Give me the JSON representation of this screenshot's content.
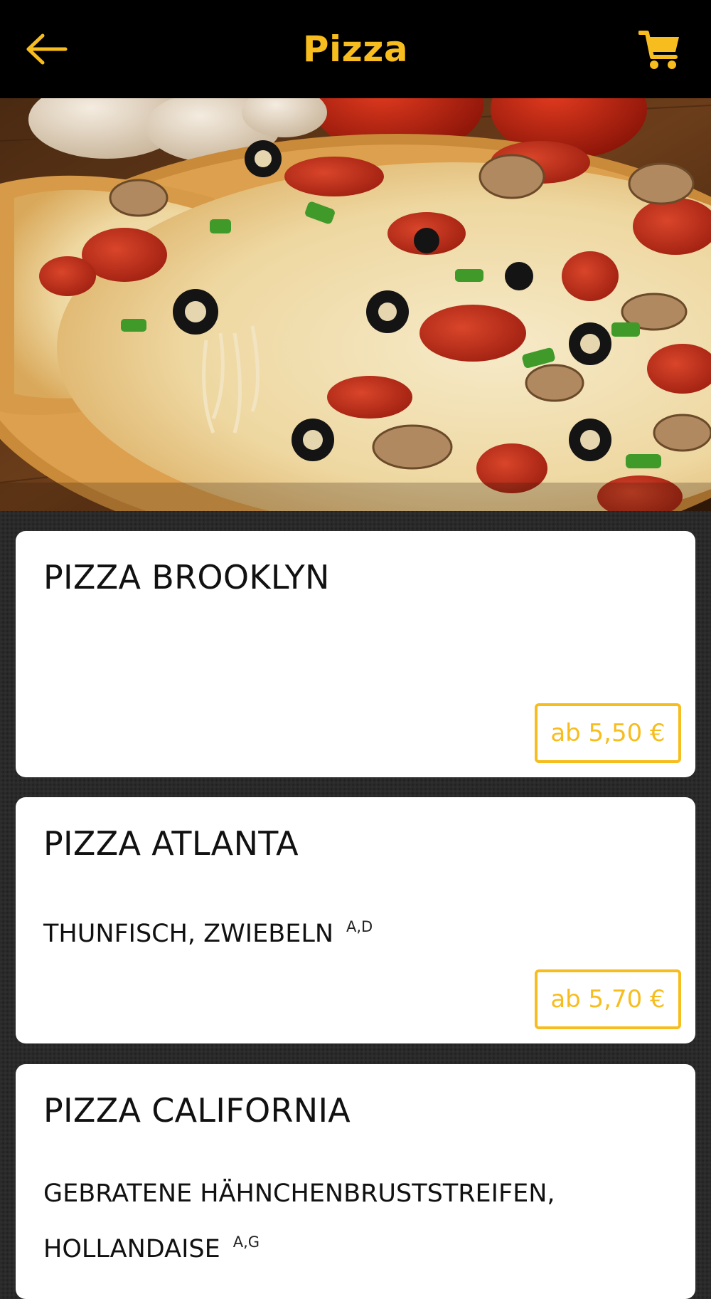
{
  "header": {
    "title": "Pizza",
    "back_icon": "arrow-left-icon",
    "cart_icon": "shopping-cart-icon",
    "accent_color": "#f7bd1e",
    "background_color": "#000000"
  },
  "hero": {
    "subject": "pizza photo"
  },
  "products": [
    {
      "name": "PIZZA BROOKLYN",
      "description": "",
      "allergens": "",
      "price": "ab 5,50 €"
    },
    {
      "name": "PIZZA ATLANTA",
      "description": "THUNFISCH, ZWIEBELN",
      "allergens": "A,D",
      "price": "ab 5,70 €"
    },
    {
      "name": "PIZZA CALIFORNIA",
      "description": "GEBRATENE HÄHNCHENBRUSTSTREIFEN, HOLLANDAISE",
      "allergens": "A,G",
      "price": ""
    }
  ]
}
